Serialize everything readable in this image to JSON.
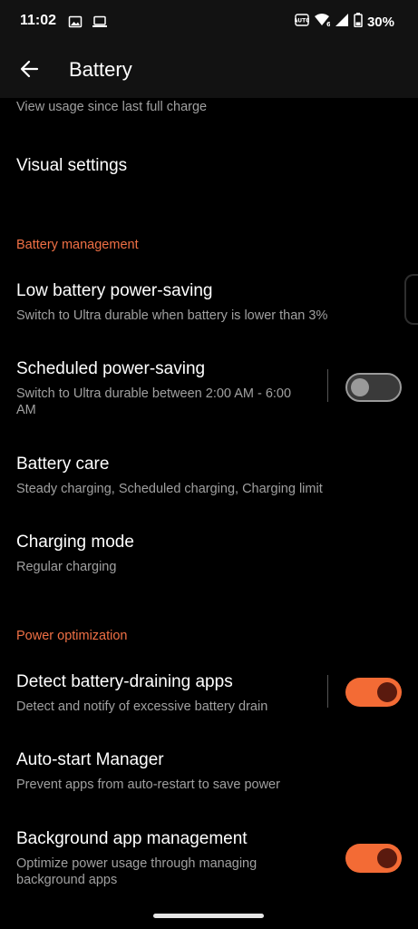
{
  "status_bar": {
    "time": "11:02",
    "battery_percent": "30%",
    "icons": [
      "gallery-icon",
      "laptop-icon",
      "auto-icon",
      "wifi-icon",
      "signal-icon",
      "battery-icon"
    ]
  },
  "app_bar": {
    "title": "Battery",
    "back_icon": "arrow-back-icon"
  },
  "items": {
    "usage_sub": "View usage since last full charge",
    "visual_settings": {
      "title": "Visual settings"
    },
    "low_battery": {
      "title": "Low battery power-saving",
      "subtitle": "Switch to Ultra durable when battery is lower than 3%"
    },
    "scheduled": {
      "title": "Scheduled power-saving",
      "subtitle": "Switch to Ultra durable between 2:00 AM - 6:00 AM",
      "toggle_on": false
    },
    "battery_care": {
      "title": "Battery care",
      "subtitle": "Steady charging, Scheduled charging, Charging limit"
    },
    "charging_mode": {
      "title": "Charging mode",
      "subtitle": "Regular charging"
    },
    "detect_draining": {
      "title": "Detect battery-draining apps",
      "subtitle": "Detect and notify of excessive battery drain",
      "toggle_on": true
    },
    "auto_start": {
      "title": "Auto-start Manager",
      "subtitle": "Prevent apps from auto-restart to save power"
    },
    "background_mgmt": {
      "title": "Background app management",
      "subtitle": "Optimize power usage through managing background apps",
      "toggle_on": true
    }
  },
  "sections": {
    "battery_management": "Battery management",
    "power_optimization": "Power optimization"
  },
  "colors": {
    "accent": "#f07045",
    "toggle_on": "#f36b35",
    "background": "#000000",
    "bar": "#121212"
  }
}
